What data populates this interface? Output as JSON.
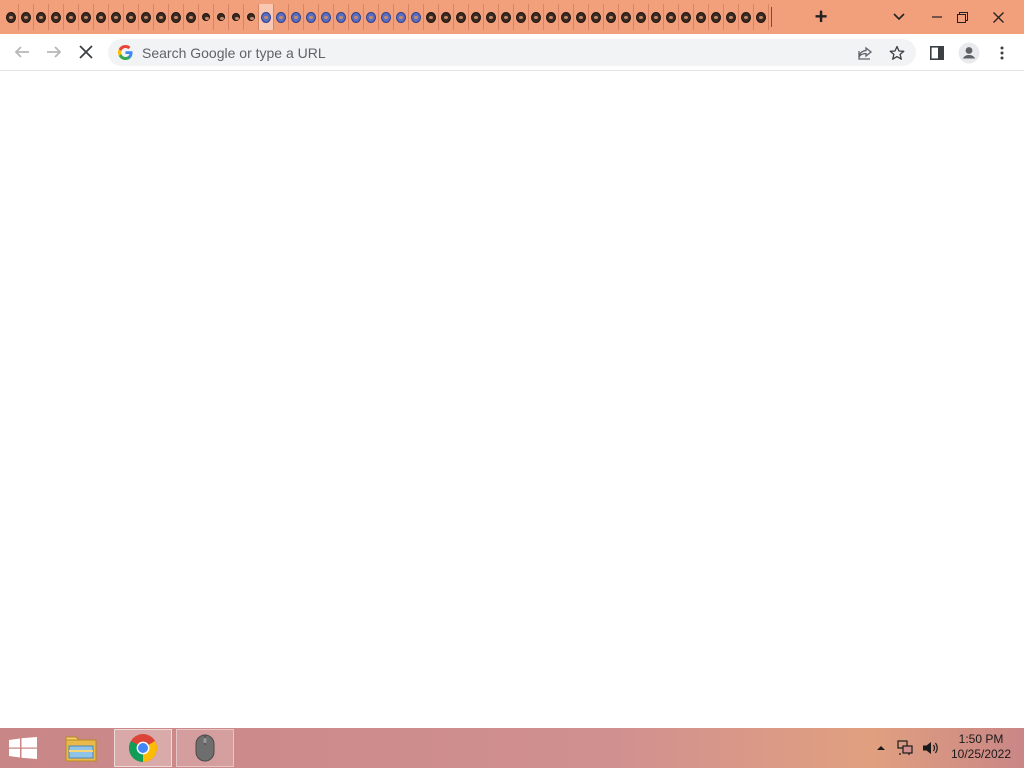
{
  "browser": {
    "tab_count": 51,
    "active_tab_index": 17,
    "new_tab_label": "+",
    "address_bar": {
      "value": "",
      "placeholder": "Search Google or type a URL"
    }
  },
  "icons": {
    "back": "arrow-left-icon",
    "forward": "arrow-right-icon",
    "stop": "stop-loading-icon",
    "google": "google-g-icon",
    "share": "share-icon",
    "bookmark": "star-icon",
    "side_panel": "side-panel-icon",
    "profile": "profile-icon",
    "menu": "kebab-menu-icon",
    "tab_search": "chevron-down-icon",
    "minimize": "minimize-icon",
    "restore": "restore-icon",
    "close": "close-icon"
  },
  "taskbar": {
    "apps": [
      "file-explorer",
      "google-chrome",
      "mouse-settings"
    ],
    "clock": {
      "time": "1:50 PM",
      "date": "10/25/2022"
    }
  },
  "colors": {
    "tabstrip": "#f2a07c",
    "taskbar": "#c98686",
    "omnibox": "#f1f3f4"
  }
}
